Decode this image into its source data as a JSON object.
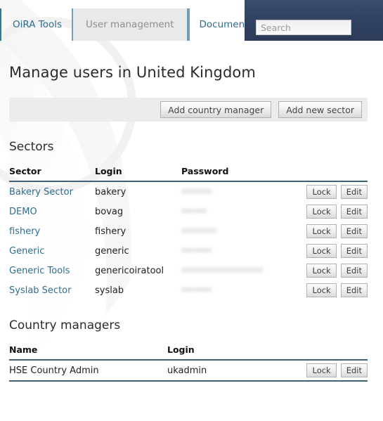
{
  "nav": {
    "tabs": [
      {
        "label": "OiRA Tools",
        "selected": false
      },
      {
        "label": "User management",
        "selected": true
      },
      {
        "label": "Documents",
        "selected": false
      }
    ]
  },
  "search": {
    "placeholder": "Search",
    "value": ""
  },
  "page": {
    "title": "Manage users in United Kingdom"
  },
  "toolbar": {
    "add_country_manager_label": "Add country manager",
    "add_new_sector_label": "Add new sector"
  },
  "sectors_section": {
    "heading": "Sectors",
    "columns": {
      "sector": "Sector",
      "login": "Login",
      "password": "Password",
      "actions": ""
    },
    "rows": [
      {
        "sector": "Bakery Sector",
        "login": "bakery",
        "password": "••••••",
        "lock_label": "Lock",
        "edit_label": "Edit"
      },
      {
        "sector": "DEMO",
        "login": "bovag",
        "password": "•••••",
        "lock_label": "Lock",
        "edit_label": "Edit"
      },
      {
        "sector": "fishery",
        "login": "fishery",
        "password": "•••••••",
        "lock_label": "Lock",
        "edit_label": "Edit"
      },
      {
        "sector": "Generic",
        "login": "generic",
        "password": "••••••",
        "lock_label": "Lock",
        "edit_label": "Edit"
      },
      {
        "sector": "Generic Tools",
        "login": "genericoiratool",
        "password": "••••••••••••••••",
        "lock_label": "Lock",
        "edit_label": "Edit"
      },
      {
        "sector": "Syslab Sector",
        "login": "syslab",
        "password": "••••••",
        "lock_label": "Lock",
        "edit_label": "Edit"
      }
    ]
  },
  "managers_section": {
    "heading": "Country managers",
    "columns": {
      "name": "Name",
      "login": "Login",
      "actions": ""
    },
    "rows": [
      {
        "name": "HSE Country Admin",
        "login": "ukadmin",
        "lock_label": "Lock",
        "edit_label": "Edit"
      }
    ]
  },
  "colors": {
    "link": "#2e6d8e",
    "header_navy": "#2f4160",
    "rule": "#3c6378",
    "toolbar_bg": "#ececec"
  }
}
